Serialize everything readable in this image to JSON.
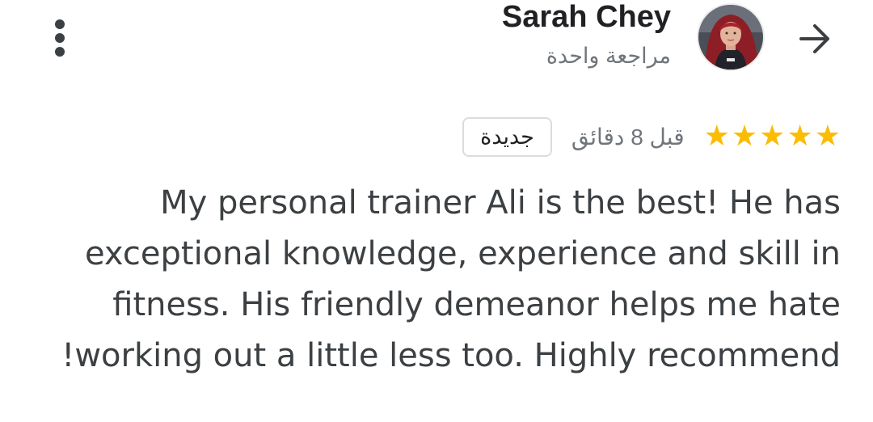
{
  "reviewer": {
    "name": "Sarah Chey",
    "review_count": "مراجعة واحدة"
  },
  "header": {
    "back_icon": "arrow-right-icon",
    "menu_icon": "more-vert-icon"
  },
  "review": {
    "rating": 5,
    "rating_max": 5,
    "star_glyph": "★",
    "star_color": "#fbbc04",
    "time": "قبل 8 دقائق",
    "badge": "جديدة",
    "text": "My personal trainer Ali is the best! He has exceptional knowledge, experience and skill in fitness. His friendly demeanor helps me hate working out a little less too. Highly recommend!"
  }
}
